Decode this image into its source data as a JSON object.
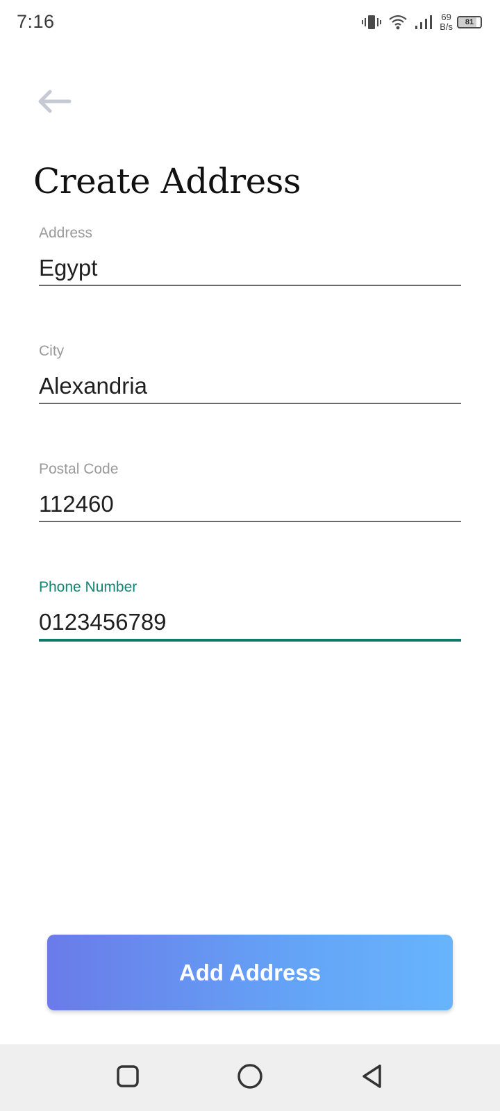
{
  "status_bar": {
    "time": "7:16",
    "net_speed_value": "69",
    "net_speed_unit": "B/s",
    "battery_level": "81",
    "icons": [
      "vibrate-icon",
      "wifi-icon",
      "signal-icon",
      "battery-icon"
    ]
  },
  "header": {
    "back_icon": "arrow-left-icon",
    "title": "Create Address"
  },
  "form": {
    "address": {
      "label": "Address",
      "value": "Egypt"
    },
    "city": {
      "label": "City",
      "value": "Alexandria"
    },
    "postal_code": {
      "label": "Postal Code",
      "value": "112460"
    },
    "phone_number": {
      "label": "Phone Number",
      "value": "0123456789",
      "focused": true
    }
  },
  "actions": {
    "submit_label": "Add Address"
  },
  "nav_bar": {
    "icons": [
      "recents-square-icon",
      "home-circle-icon",
      "back-triangle-icon"
    ]
  },
  "colors": {
    "accent": "#0f7a6a",
    "button_gradient_start": "#6a7be9",
    "button_gradient_end": "#67b4fd",
    "nav_bar_bg": "#efefef"
  }
}
